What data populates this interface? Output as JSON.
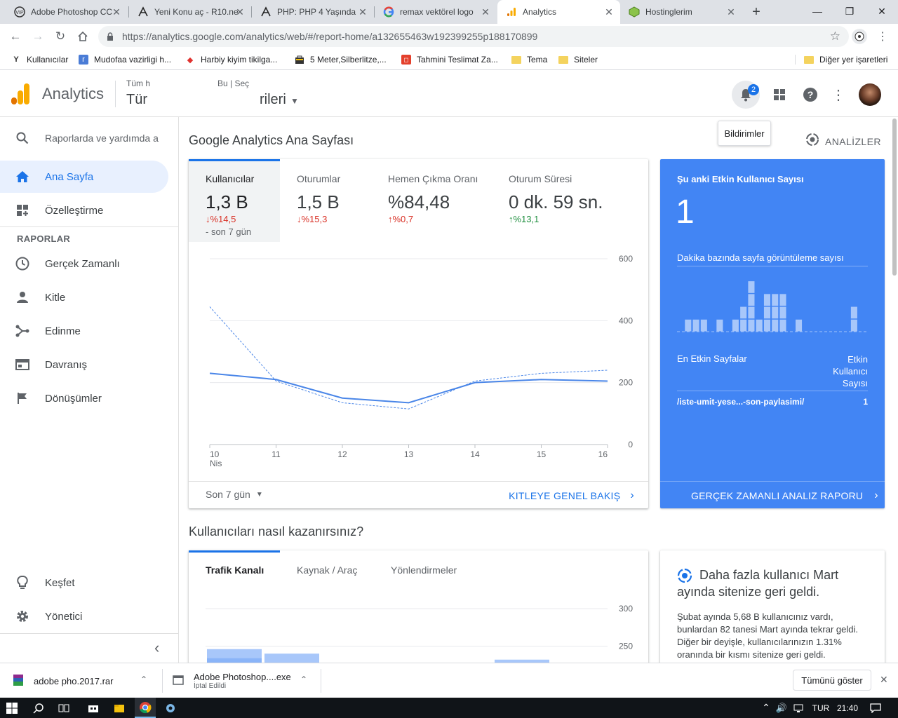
{
  "browser": {
    "tabs": [
      {
        "title": "Adobe Photoshop CC",
        "icon": "vip-icon"
      },
      {
        "title": "Yeni Konu aç - R10.ne",
        "icon": "r10-icon"
      },
      {
        "title": "PHP: PHP 4 Yaşında ",
        "icon": "r10-icon"
      },
      {
        "title": "remax vektörel logo ",
        "icon": "google-icon"
      },
      {
        "title": "Analytics",
        "icon": "analytics-icon"
      },
      {
        "title": "Hostinglerim",
        "icon": "hosting-icon"
      }
    ],
    "new_tab": "+",
    "url": "https://analytics.google.com/analytics/web/#/report-home/a132655463w192399255p188170899",
    "bookmarks": [
      {
        "label": "Kullanıcılar"
      },
      {
        "label": "Mudofaa vazirligi h..."
      },
      {
        "label": "Harbiy kiyim tikilga..."
      },
      {
        "label": "5 Meter,Silberlitze,..."
      },
      {
        "label": "Tahmini Teslimat Za..."
      },
      {
        "label": "Tema"
      },
      {
        "label": "Siteler"
      }
    ],
    "other_bookmarks": "Diğer yer işaretleri"
  },
  "header": {
    "product": "Analytics",
    "account_line1": "Tüm hesa",
    "account_line1b": "Bu | Seç",
    "account_line2": "Tür",
    "account_line2b": "rileri",
    "notification_count": "2",
    "tooltip": "Bildirimler"
  },
  "sidebar": {
    "search_placeholder": "Raporlarda ve yardımda a",
    "home": "Ana Sayfa",
    "customize": "Özelleştirme",
    "reports_heading": "RAPORLAR",
    "items": [
      "Gerçek Zamanlı",
      "Kitle",
      "Edinme",
      "Davranış",
      "Dönüşümler"
    ],
    "discover": "Keşfet",
    "admin": "Yönetici",
    "collapse": "‹"
  },
  "main": {
    "title": "Google Analytics Ana Sayfası",
    "insights": "ANALİZLER",
    "metrics": [
      {
        "label": "Kullanıcılar",
        "value": "1,3 B",
        "delta": "↓%14,5",
        "dir": "down",
        "sub": "- son 7 gün"
      },
      {
        "label": "Oturumlar",
        "value": "1,5 B",
        "delta": "↓%15,3",
        "dir": "down"
      },
      {
        "label": "Hemen Çıkma Oranı",
        "value": "%84,48",
        "delta": "↑%0,7",
        "dir": "down"
      },
      {
        "label": "Oturum Süresi",
        "value": "0 dk. 59 sn.",
        "delta": "↑%13,1",
        "dir": "up"
      }
    ],
    "period": "Son 7 gün",
    "audience_link": "KITLEYE GENEL BAKIŞ",
    "section2_title": "Kullanıcıları nasıl kazanırsınız?",
    "acq_tabs": [
      "Trafik Kanalı",
      "Kaynak / Araç",
      "Yönlendirmeler"
    ]
  },
  "chart_data": [
    {
      "type": "line",
      "x": [
        "10",
        "11",
        "12",
        "13",
        "14",
        "15",
        "16"
      ],
      "x_sublabel": "Nis",
      "y_ticks": [
        "600",
        "400",
        "200",
        "0"
      ],
      "ylim": [
        0,
        600
      ],
      "series": [
        {
          "values": [
            230,
            210,
            150,
            135,
            200,
            210,
            205
          ]
        },
        {
          "values": [
            445,
            205,
            135,
            115,
            205,
            230,
            240
          ]
        }
      ]
    },
    {
      "type": "bar",
      "values": [
        0,
        1,
        1,
        1,
        0,
        1,
        0,
        1,
        2,
        4,
        1,
        3,
        3,
        3,
        0,
        1,
        0,
        0,
        0,
        0,
        0,
        0,
        2,
        0
      ]
    },
    {
      "type": "bar",
      "y_ticks": [
        "300",
        "250"
      ],
      "values": [
        246,
        240,
        0,
        0,
        0,
        232
      ]
    }
  ],
  "realtime": {
    "title": "Şu anki Etkin Kullanıcı Sayısı",
    "count": "1",
    "pageviews_label": "Dakika bazında sayfa görüntüleme sayısı",
    "top_pages_label": "En Etkin Sayfalar",
    "active_users_label": "Etkin Kullanıcı Sayısı",
    "page": "/iste-umit-yese...-son-paylasimi/",
    "page_count": "1",
    "link": "GERÇEK ZAMANLI ANALIZ RAPORU"
  },
  "insight_card": {
    "title": "Daha fazla kullanıcı Mart ayında sitenize geri geldi.",
    "body": "Şubat ayında 5,68 B kullanıcınız vardı, bunlardan 82 tanesi Mart ayında tekrar geldi. Diğer bir deyişle, kullanıcılarınızın 1.31% oranında bir kısmı sitenize geri geldi."
  },
  "downloads": [
    {
      "name": "adobe pho.2017.rar"
    },
    {
      "name": "Adobe Photoshop....exe",
      "status": "İptal Edildi"
    }
  ],
  "show_all": "Tümünü göster",
  "taskbar": {
    "lang": "TUR",
    "time": "21:40"
  },
  "colors": {
    "blue": "#1a73e8",
    "realtime_bg": "#4285f4",
    "orange": "#f9ab00"
  }
}
